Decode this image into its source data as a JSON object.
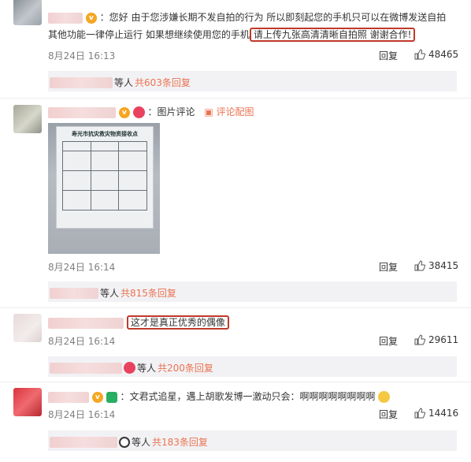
{
  "comments": [
    {
      "text_before": "：您好 由于您涉嫌长期不发自拍的行为 所以即刻起您的手机只可以在微博发送自拍 其他功能一律停止运行 如果想继续使用您的手机",
      "highlight": "请上传九张高清清晰自拍照 谢谢合作!",
      "time": "8月24日 16:13",
      "reply_label": "回复",
      "likes": "48465",
      "sub_suffix": "等人",
      "sub_count": "共603条回复"
    },
    {
      "text": "：图片评论",
      "image_link": "评论配图",
      "photo_title": "寿光市抗灾救灾物资接收点",
      "time": "8月24日 16:14",
      "reply_label": "回复",
      "likes": "38415",
      "sub_suffix": "等人",
      "sub_count": "共815条回复"
    },
    {
      "highlight": "这才是真正优秀的偶像",
      "time": "8月24日 16:14",
      "reply_label": "回复",
      "likes": "29611",
      "sub_suffix": "等人",
      "sub_count": "共200条回复"
    },
    {
      "text": "：文君式追星，遇上胡歌发博一激动只会：",
      "emphasis": "啊啊啊啊啊啊啊啊",
      "time": "8月24日 16:14",
      "reply_label": "回复",
      "likes": "14416",
      "sub_suffix": "等人",
      "sub_count": "共183条回复"
    }
  ],
  "colors": {
    "link": "#eb7350",
    "highlight_border": "#c0392b",
    "subbar_bg": "#f2f2f5"
  }
}
